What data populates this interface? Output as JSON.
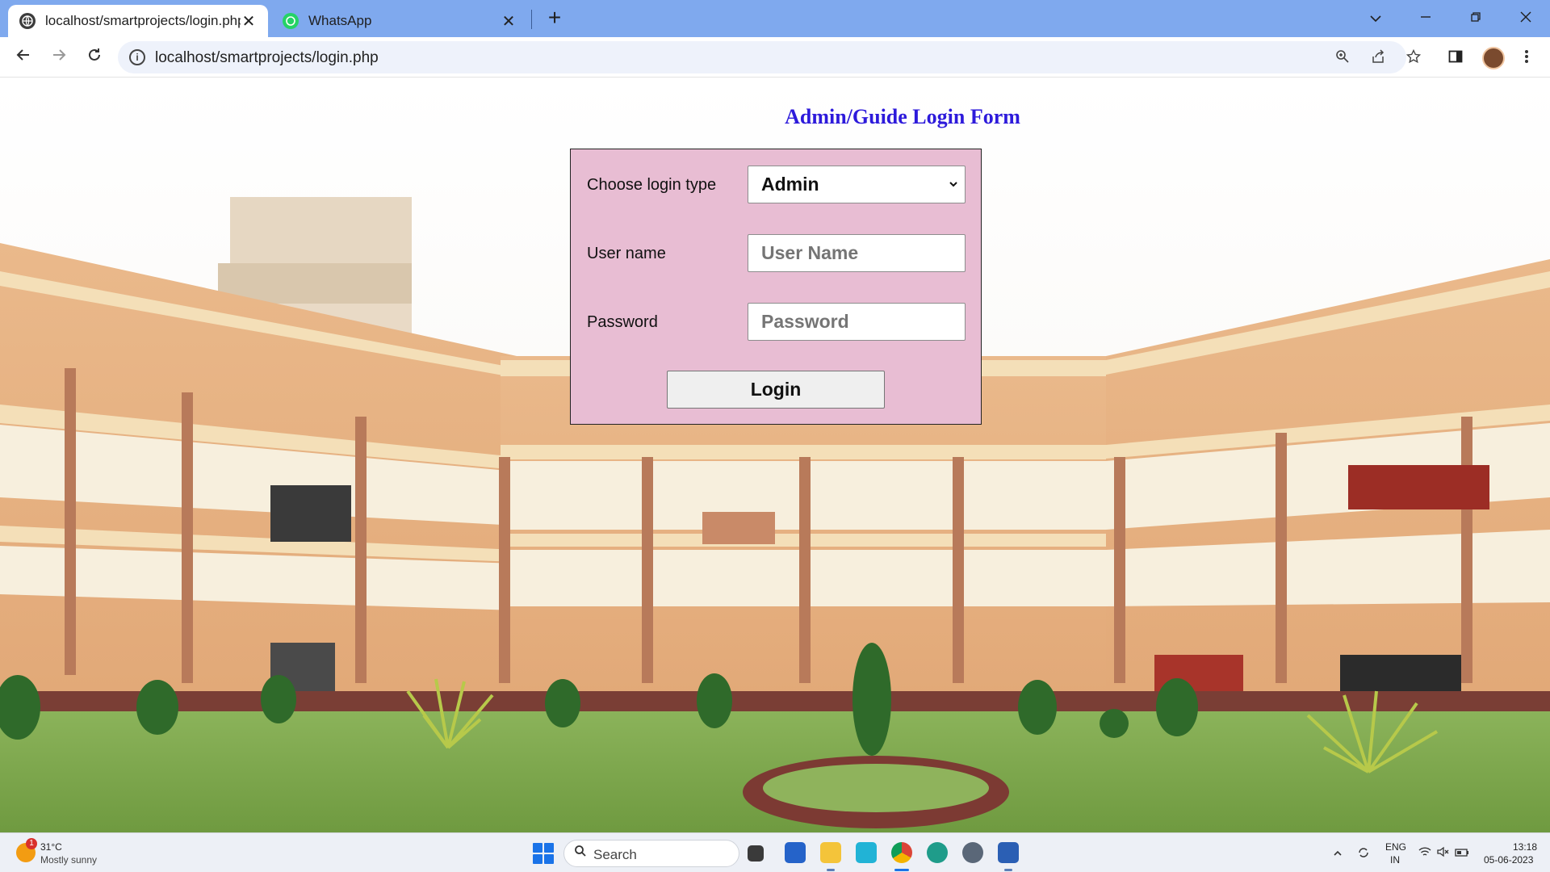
{
  "browser": {
    "tabs": [
      {
        "title": "localhost/smartprojects/login.php",
        "active": true
      },
      {
        "title": "WhatsApp",
        "active": false
      }
    ],
    "new_tab_symbol": "+",
    "tab_close_symbol": "✕",
    "url": "localhost/smartprojects/login.php",
    "icons": {
      "back": "arrow-left-icon",
      "forward": "arrow-right-icon",
      "reload": "reload-icon",
      "site_info": "info-icon",
      "zoom": "zoom-icon",
      "share": "share-icon",
      "bookmark": "star-icon",
      "side_panel": "side-panel-icon",
      "menu": "kebab-menu-icon"
    }
  },
  "page": {
    "heading": "Admin/Guide Login Form",
    "form": {
      "login_type_label": "Choose login type",
      "login_type_value": "Admin",
      "username_label": "User name",
      "username_placeholder": "User Name",
      "password_label": "Password",
      "password_placeholder": "Password",
      "submit_label": "Login"
    },
    "colors": {
      "heading": "#2d1adb",
      "form_background": "#e8bdd3"
    }
  },
  "taskbar": {
    "weather": {
      "temperature": "31°C",
      "description": "Mostly sunny",
      "badge": "1"
    },
    "search_placeholder": "Search",
    "apps": [
      "file-explorer-icon",
      "store-icon",
      "folder-icon",
      "photos-icon",
      "chrome-icon",
      "edge-icon",
      "settings-icon",
      "word-icon"
    ],
    "language": {
      "line1": "ENG",
      "line2": "IN"
    },
    "time": "13:18",
    "date": "05-06-2023"
  }
}
